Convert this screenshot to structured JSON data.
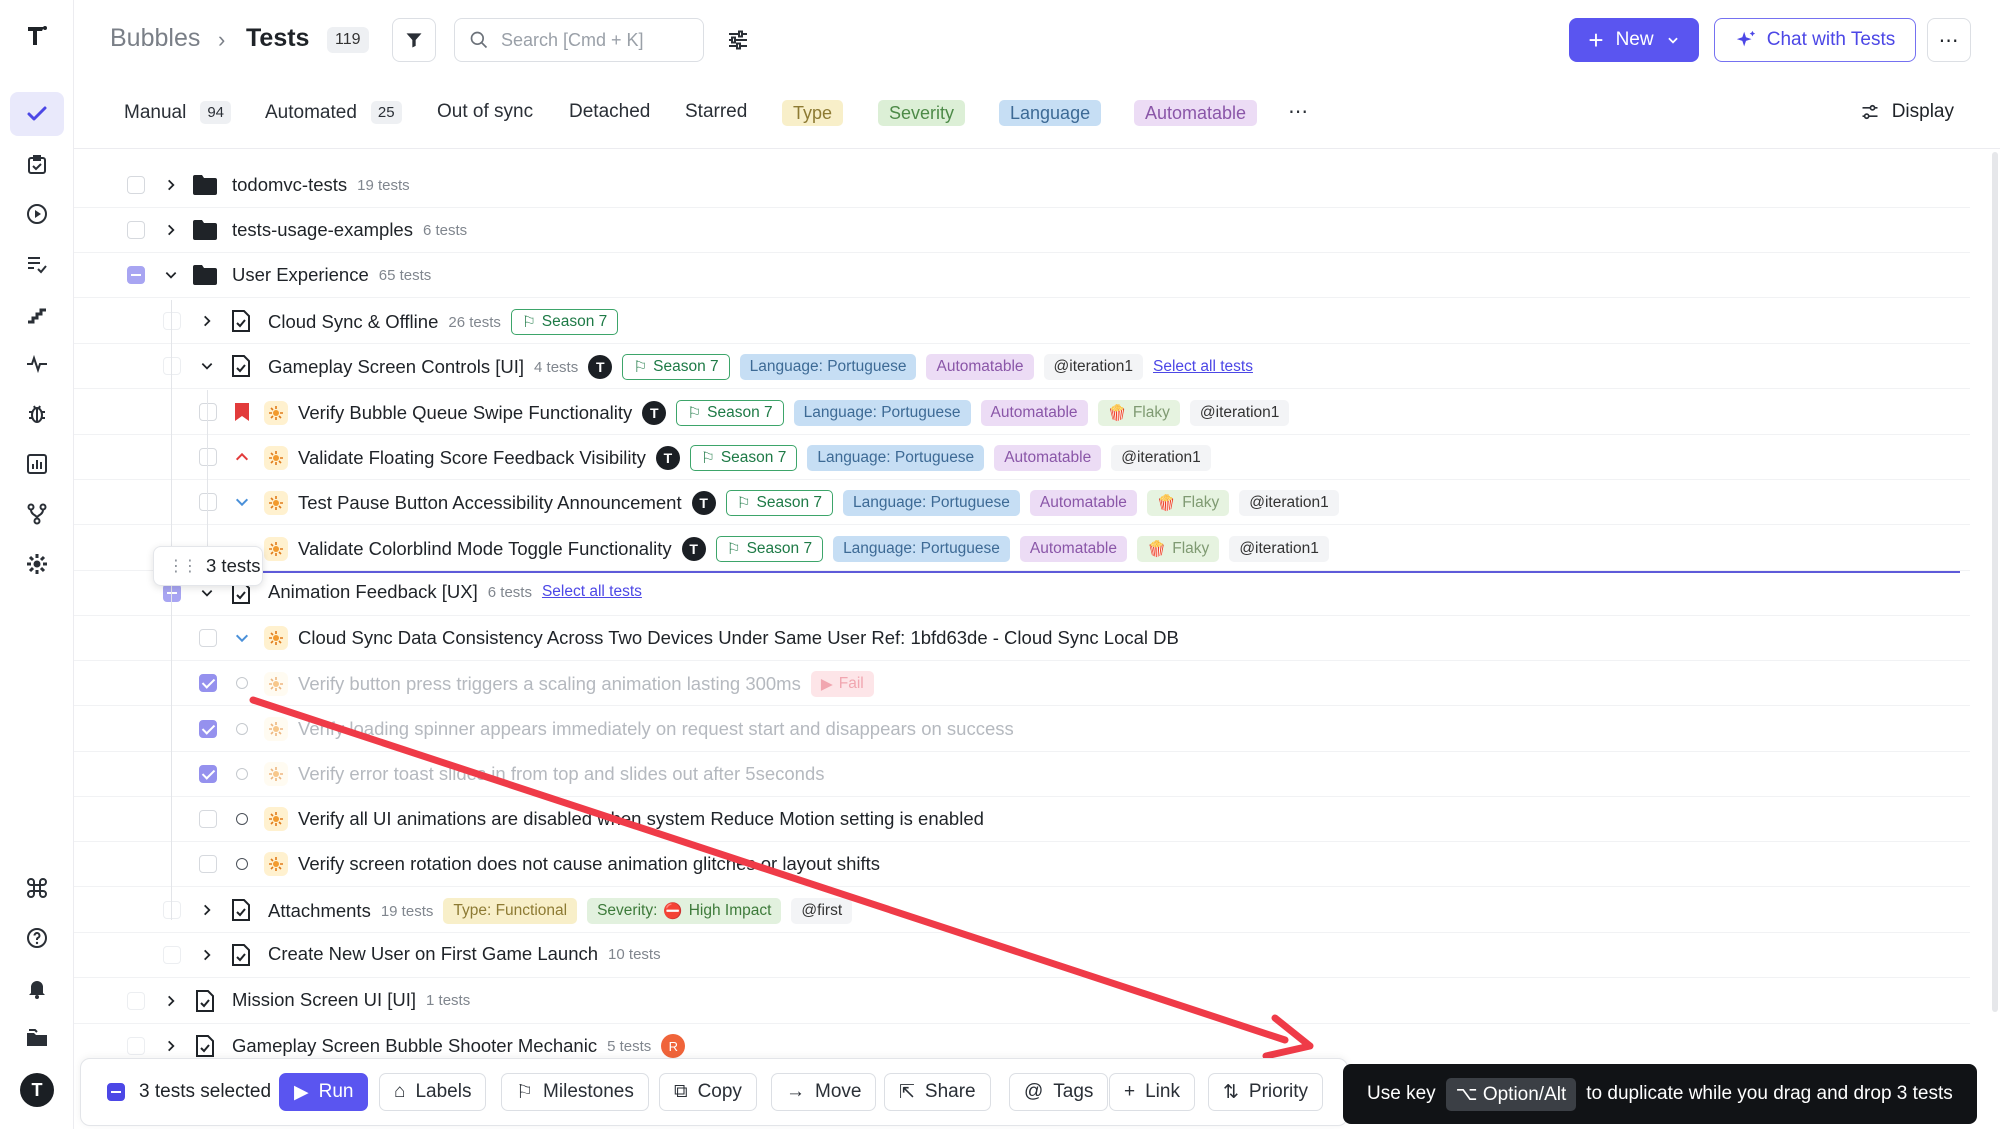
{
  "header": {
    "breadcrumb_root": "Bubbles",
    "breadcrumb_sep": "›",
    "title": "Tests",
    "count": "119",
    "search_placeholder": "Search [Cmd + K]",
    "new_label": "New",
    "chat_label": "Chat with Tests",
    "more_label": "⋯"
  },
  "filters": {
    "tabs": [
      {
        "label": "Manual",
        "count": "94"
      },
      {
        "label": "Automated",
        "count": "25"
      },
      {
        "label": "Out of sync"
      },
      {
        "label": "Detached"
      },
      {
        "label": "Starred"
      }
    ],
    "chips": [
      "Type",
      "Severity",
      "Language",
      "Automatable"
    ],
    "overflow": "⋯",
    "display_label": "Display"
  },
  "tree": {
    "folders": [
      {
        "name": "todomvc-tests",
        "count": "19 tests"
      },
      {
        "name": "tests-usage-examples",
        "count": "6 tests"
      },
      {
        "name": "User Experience",
        "count": "65 tests"
      }
    ],
    "suites": {
      "cloud_sync": {
        "name": "Cloud Sync & Offline",
        "count": "26 tests",
        "milestone": "Season 7"
      },
      "gameplay_controls": {
        "name": "Gameplay Screen Controls [UI]",
        "count": "4 tests",
        "milestone": "Season 7",
        "language": "Language: Portuguese",
        "automatable": "Automatable",
        "iteration": "@iteration1",
        "select_all": "Select all tests"
      },
      "animation_feedback": {
        "name": "Animation Feedback [UX]",
        "count": "6 tests",
        "select_all": "Select all tests"
      },
      "attachments": {
        "name": "Attachments",
        "count": "19 tests",
        "type": "Type: Functional",
        "severity_prefix": "Severity:",
        "severity_value": "High Impact",
        "label": "@first"
      },
      "create_user": {
        "name": "Create New User on First Game Launch",
        "count": "10 tests"
      },
      "mission_screen": {
        "name": "Mission Screen UI [UI]",
        "count": "1 tests"
      },
      "bubble_shooter": {
        "name": "Gameplay Screen Bubble Shooter Mechanic",
        "count": "5 tests",
        "avatar": "R"
      }
    },
    "gameplay_tests": [
      {
        "name": "Verify Bubble Queue Swipe Functionality",
        "milestone": "Season 7",
        "language": "Language: Portuguese",
        "automatable": "Automatable",
        "flaky": "Flaky",
        "iteration": "@iteration1"
      },
      {
        "name": "Validate Floating Score Feedback Visibility",
        "milestone": "Season 7",
        "language": "Language: Portuguese",
        "automatable": "Automatable",
        "iteration": "@iteration1"
      },
      {
        "name": "Test Pause Button Accessibility Announcement",
        "milestone": "Season 7",
        "language": "Language: Portuguese",
        "automatable": "Automatable",
        "flaky": "Flaky",
        "iteration": "@iteration1"
      },
      {
        "name": "Validate Colorblind Mode Toggle Functionality",
        "milestone": "Season 7",
        "language": "Language: Portuguese",
        "automatable": "Automatable",
        "flaky": "Flaky",
        "iteration": "@iteration1"
      }
    ],
    "animation_tests": [
      {
        "name": "Cloud Sync Data Consistency Across Two Devices Under Same User Ref: 1bfd63de - Cloud Sync Local DB"
      },
      {
        "name": "Verify button press triggers a scaling animation lasting 300ms",
        "status": "Fail"
      },
      {
        "name": "Verify loading spinner appears immediately on request start and disappears on success"
      },
      {
        "name": "Verify error toast slides in from top and slides out after 5seconds"
      },
      {
        "name": "Verify all UI animations are disabled when system Reduce Motion setting is enabled"
      },
      {
        "name": "Verify screen rotation does not cause animation glitches or layout shifts"
      }
    ]
  },
  "drag": {
    "label": "3 tests"
  },
  "bottom_bar": {
    "selected": "3 tests selected",
    "run": "Run",
    "labels": "Labels",
    "milestones": "Milestones",
    "copy": "Copy",
    "move": "Move",
    "share": "Share",
    "tags": "Tags",
    "link": "Link",
    "priority": "Priority"
  },
  "tooltip": {
    "prefix": "Use key",
    "key": "⌥ Option/Alt",
    "suffix": "to duplicate while you drag and drop 3 tests"
  },
  "colors": {
    "accent": "#5a55f0",
    "arrow": "#ef3b48",
    "type_chip": "#f8efc9",
    "severity_chip": "#dcefd6",
    "language_chip": "#c6def4",
    "automatable_chip": "#ecdcf5"
  },
  "icons": [
    "logo-t-icon",
    "check-icon",
    "clipboard-icon",
    "play-circle-icon",
    "list-check-icon",
    "steps-icon",
    "pulse-icon",
    "bug-icon",
    "chart-icon",
    "branch-icon",
    "gear-icon",
    "command-icon",
    "help-icon",
    "bell-icon",
    "folders-icon",
    "avatar-icon",
    "filter-icon",
    "search-icon",
    "sliders-icon",
    "sparkle-icon",
    "chevron-down-icon",
    "chevron-right-icon",
    "folder-icon",
    "suite-icon",
    "critical-flag-icon",
    "priority-up-icon",
    "priority-down-icon",
    "drag-handle-icon",
    "test-case-icon"
  ]
}
